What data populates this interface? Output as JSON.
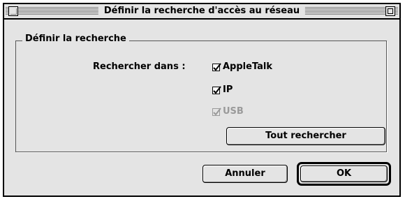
{
  "window": {
    "title": "Définir la recherche d'accès au réseau"
  },
  "group": {
    "label": "Définir la recherche"
  },
  "search": {
    "label": "Rechercher dans :",
    "options": [
      {
        "label": "AppleTalk",
        "checked": true,
        "enabled": true
      },
      {
        "label": "IP",
        "checked": true,
        "enabled": true
      },
      {
        "label": "USB",
        "checked": true,
        "enabled": false
      }
    ],
    "search_all_label": "Tout rechercher"
  },
  "buttons": {
    "cancel_label": "Annuler",
    "ok_label": "OK"
  }
}
